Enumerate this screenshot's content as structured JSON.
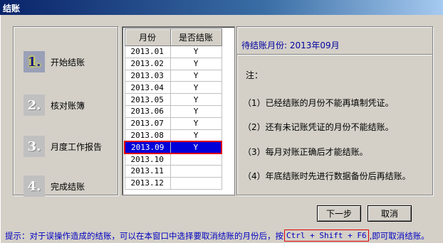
{
  "window": {
    "title": "结账"
  },
  "steps": [
    {
      "number": "1.",
      "label": "开始结账",
      "active": true
    },
    {
      "number": "2.",
      "label": "核对账簿",
      "active": false
    },
    {
      "number": "3.",
      "label": "月度工作报告",
      "active": false
    },
    {
      "number": "4.",
      "label": "完成结账",
      "active": false
    }
  ],
  "table": {
    "headers": [
      "月份",
      "是否结账"
    ],
    "rows": [
      {
        "month": "2013.01",
        "closed": "Y"
      },
      {
        "month": "2013.02",
        "closed": "Y"
      },
      {
        "month": "2013.03",
        "closed": "Y"
      },
      {
        "month": "2013.04",
        "closed": "Y"
      },
      {
        "month": "2013.05",
        "closed": "Y"
      },
      {
        "month": "2013.06",
        "closed": "Y"
      },
      {
        "month": "2013.07",
        "closed": "Y"
      },
      {
        "month": "2013.08",
        "closed": "Y"
      },
      {
        "month": "2013.09",
        "closed": "Y",
        "selected": true
      },
      {
        "month": "2013.10",
        "closed": ""
      },
      {
        "month": "2013.11",
        "closed": ""
      },
      {
        "month": "2013.12",
        "closed": ""
      }
    ]
  },
  "info": {
    "pending_label": "待结账月份: 2013年09月",
    "note_title": "注：",
    "notes": [
      "（1）已经结账的月份不能再填制凭证。",
      "（2）还有未记账凭证的月份不能结账。",
      "（3）每月对账正确后才能结账。",
      "（4）年底结账时先进行数据备份后再结账。"
    ]
  },
  "buttons": {
    "next": "下一步",
    "cancel": "取消"
  },
  "hint": {
    "prefix": "提示：对于误操作造成的结账，可以在本窗口中选择要取消结账的月份后，按",
    "shortcut": "Ctrl + Shift + F6",
    "suffix": ",即可取消结账。"
  },
  "colors": {
    "selection": "#0000d8",
    "highlight": "#e00000",
    "hint": "#0000c0"
  }
}
